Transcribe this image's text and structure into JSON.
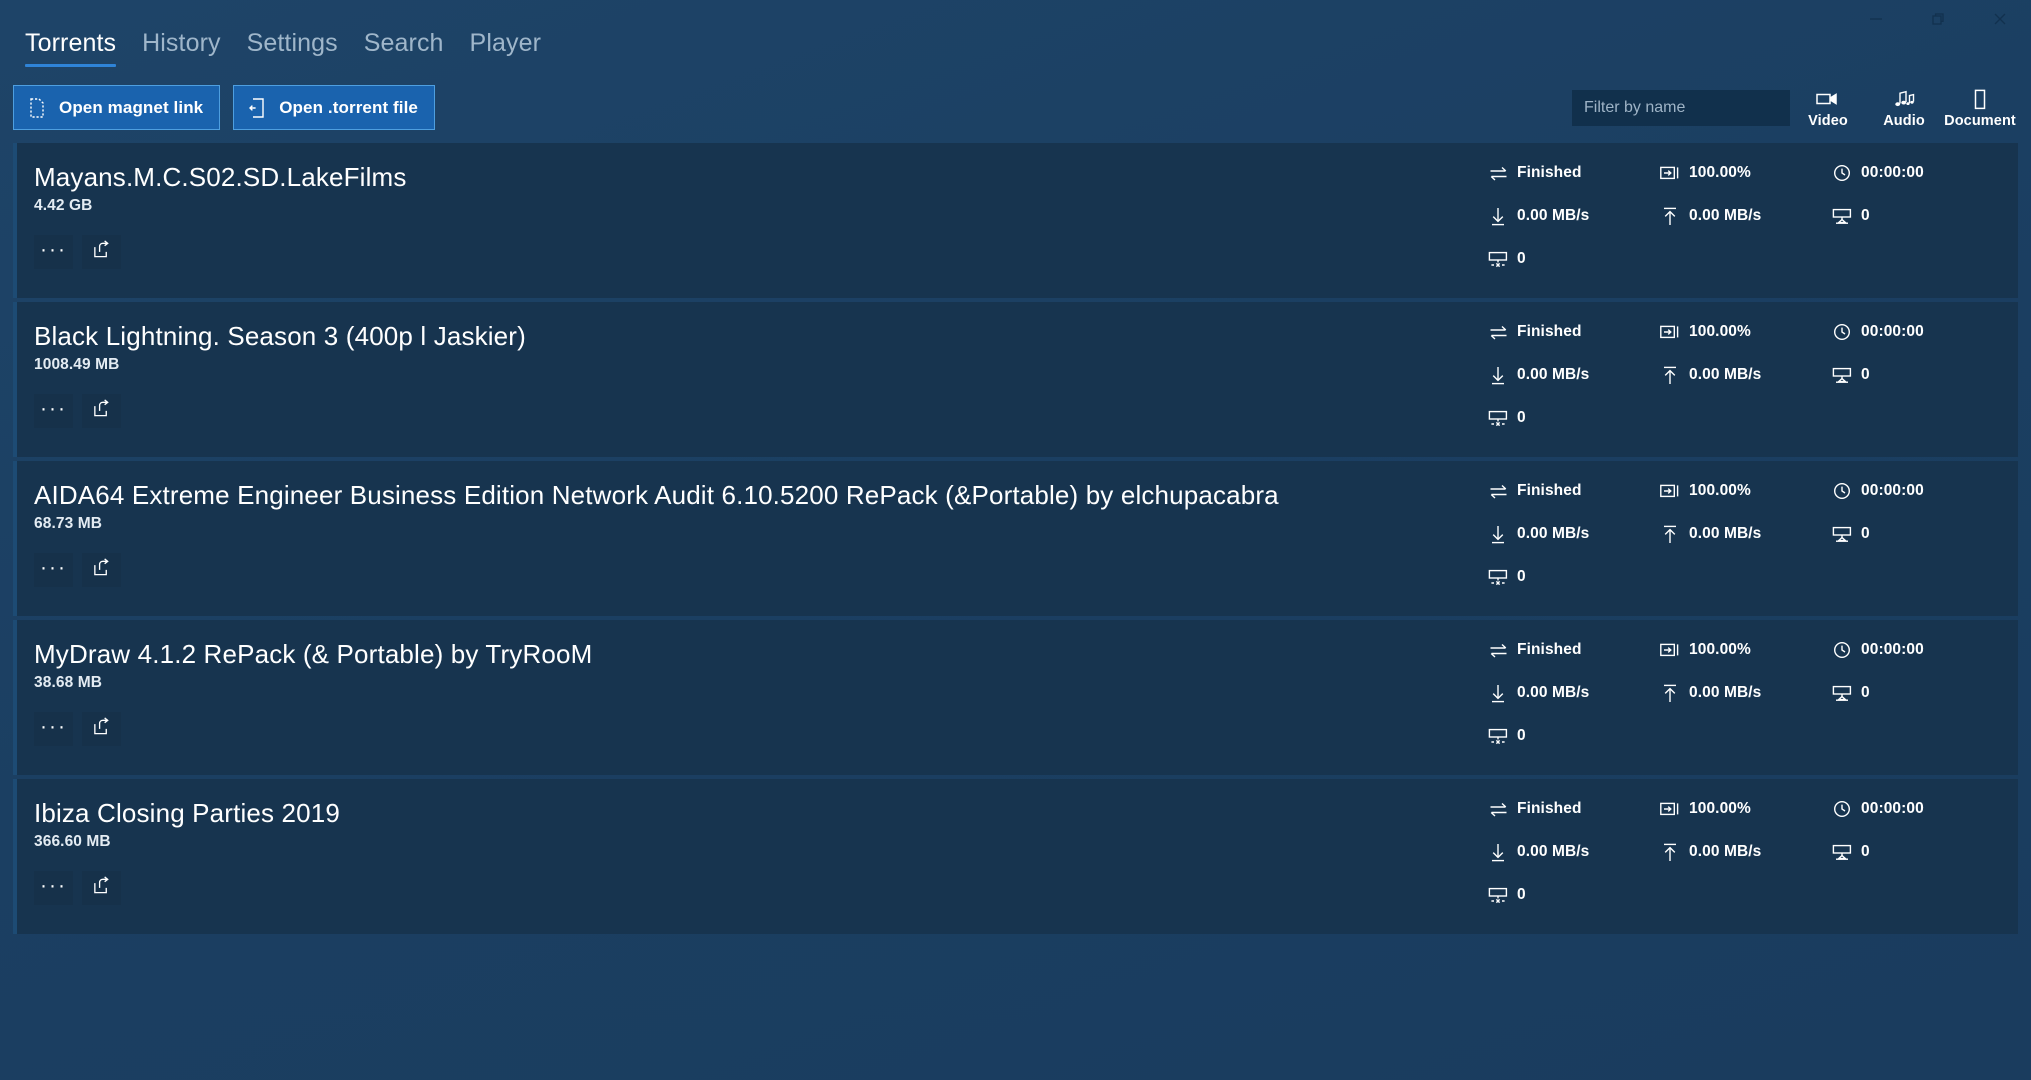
{
  "window": {
    "controls": [
      {
        "name": "minimize",
        "glyph": "minimize-icon"
      },
      {
        "name": "restore",
        "glyph": "restore-icon"
      },
      {
        "name": "close",
        "glyph": "close-icon"
      }
    ]
  },
  "nav": {
    "tabs": [
      {
        "label": "Torrents",
        "active": true
      },
      {
        "label": "History",
        "active": false
      },
      {
        "label": "Settings",
        "active": false
      },
      {
        "label": "Search",
        "active": false
      },
      {
        "label": "Player",
        "active": false
      }
    ],
    "active_indicator_color": "#2f84d8"
  },
  "toolbar": {
    "open_magnet_label": "Open magnet link",
    "open_magnet_icon": "magnet-file-icon",
    "open_torrent_label": "Open .torrent file",
    "open_torrent_icon": "torrent-file-icon",
    "button_color": "#1a63ae",
    "button_border_color": "#4e9fe0",
    "filter": {
      "value": "",
      "placeholder": "Filter by name",
      "background": "#11304c"
    },
    "categories": [
      {
        "label": "Video",
        "icon": "video-camera-icon"
      },
      {
        "label": "Audio",
        "icon": "music-notes-icon"
      },
      {
        "label": "Document",
        "icon": "document-page-icon"
      }
    ]
  },
  "theme": {
    "page_background": "#1b3f62",
    "row_background": "#17344f",
    "accent": "#2f84d8",
    "text_primary": "#ffffff",
    "text_muted": "#9fb6ca"
  },
  "stat_labels": {
    "status_icon": "transfer-arrows-icon",
    "progress_icon": "progress-bar-icon",
    "time_icon": "clock-icon",
    "download_icon": "download-arrow-icon",
    "upload_icon": "upload-arrow-icon",
    "seeds_icon": "seeds-monitor-icon",
    "peers_icon": "peers-monitor-icon",
    "more_icon": "more-options-icon",
    "share_icon": "share-icon"
  },
  "torrents": [
    {
      "name": "Mayans.M.C.S02.SD.LakeFilms",
      "size": "4.42 GB",
      "status": "Finished",
      "progress": "100.00%",
      "time": "00:00:00",
      "download_speed": "0.00 MB/s",
      "upload_speed": "0.00 MB/s",
      "seeds": "0",
      "peers": "0"
    },
    {
      "name": "Black Lightning. Season 3 (400p l Jaskier)",
      "size": "1008.49 MB",
      "status": "Finished",
      "progress": "100.00%",
      "time": "00:00:00",
      "download_speed": "0.00 MB/s",
      "upload_speed": "0.00 MB/s",
      "seeds": "0",
      "peers": "0"
    },
    {
      "name": "AIDA64 Extreme  Engineer  Business Edition  Network Audit 6.10.5200 RePack (&Portable) by elchupacabra",
      "size": "68.73 MB",
      "status": "Finished",
      "progress": "100.00%",
      "time": "00:00:00",
      "download_speed": "0.00 MB/s",
      "upload_speed": "0.00 MB/s",
      "seeds": "0",
      "peers": "0"
    },
    {
      "name": "MyDraw 4.1.2 RePack (& Portable) by TryRooM",
      "size": "38.68 MB",
      "status": "Finished",
      "progress": "100.00%",
      "time": "00:00:00",
      "download_speed": "0.00 MB/s",
      "upload_speed": "0.00 MB/s",
      "seeds": "0",
      "peers": "0"
    },
    {
      "name": "Ibiza Closing Parties 2019",
      "size": "366.60 MB",
      "status": "Finished",
      "progress": "100.00%",
      "time": "00:00:00",
      "download_speed": "0.00 MB/s",
      "upload_speed": "0.00 MB/s",
      "seeds": "0",
      "peers": "0"
    }
  ]
}
